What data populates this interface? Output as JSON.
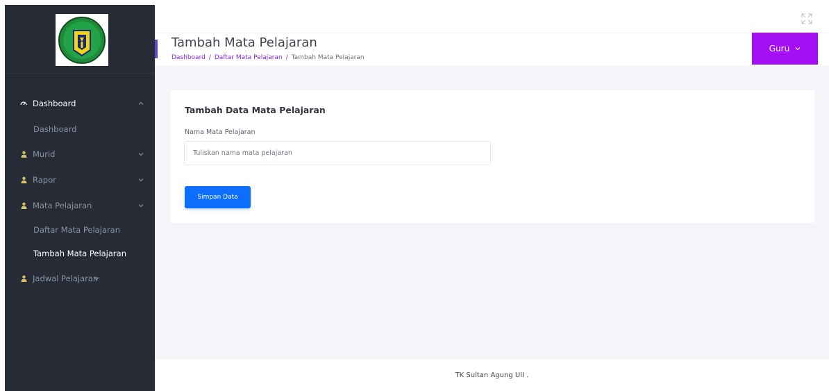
{
  "header": {
    "title": "Tambah Mata Pelajaran",
    "breadcrumb": [
      {
        "label": "Dashboard"
      },
      {
        "label": "Daftar Mata Pelajaran"
      },
      {
        "label": "Tambah Mata Pelajaran"
      }
    ],
    "breadcrumb_separator": "/",
    "user_menu_label": "Guru"
  },
  "sidebar": {
    "logo_icon": "school-logo-icon",
    "items": [
      {
        "label": "Dashboard",
        "icon": "dashboard-icon",
        "expanded": true
      },
      {
        "label": "Murid",
        "icon": "person-icon"
      },
      {
        "label": "Rapor",
        "icon": "person-icon"
      },
      {
        "label": "Mata Pelajaran",
        "icon": "person-icon",
        "expanded": true
      },
      {
        "label": "Jadwal Pelajaran",
        "icon": "person-icon"
      }
    ],
    "subitems": {
      "dashboard": [
        {
          "label": "Dashboard"
        }
      ],
      "mata_pelajaran": [
        {
          "label": "Daftar Mata Pelajaran"
        },
        {
          "label": "Tambah Mata Pelajaran"
        }
      ]
    }
  },
  "form": {
    "card_title": "Tambah Data Mata Pelajaran",
    "field_label": "Nama Mata Pelajaran",
    "field_value": "",
    "field_placeholder": "Tuliskan nama mata pelajaran",
    "submit_label": "Simpan Data"
  },
  "footer": {
    "text": "TK Sultan Agung UII ."
  },
  "colors": {
    "sidebar_bg": "#262b36",
    "accent_purple": "#a40ff3",
    "breadcrumb_link": "#8a22e8",
    "primary_button": "#0d6efd",
    "content_bg": "#f3f5f9"
  }
}
